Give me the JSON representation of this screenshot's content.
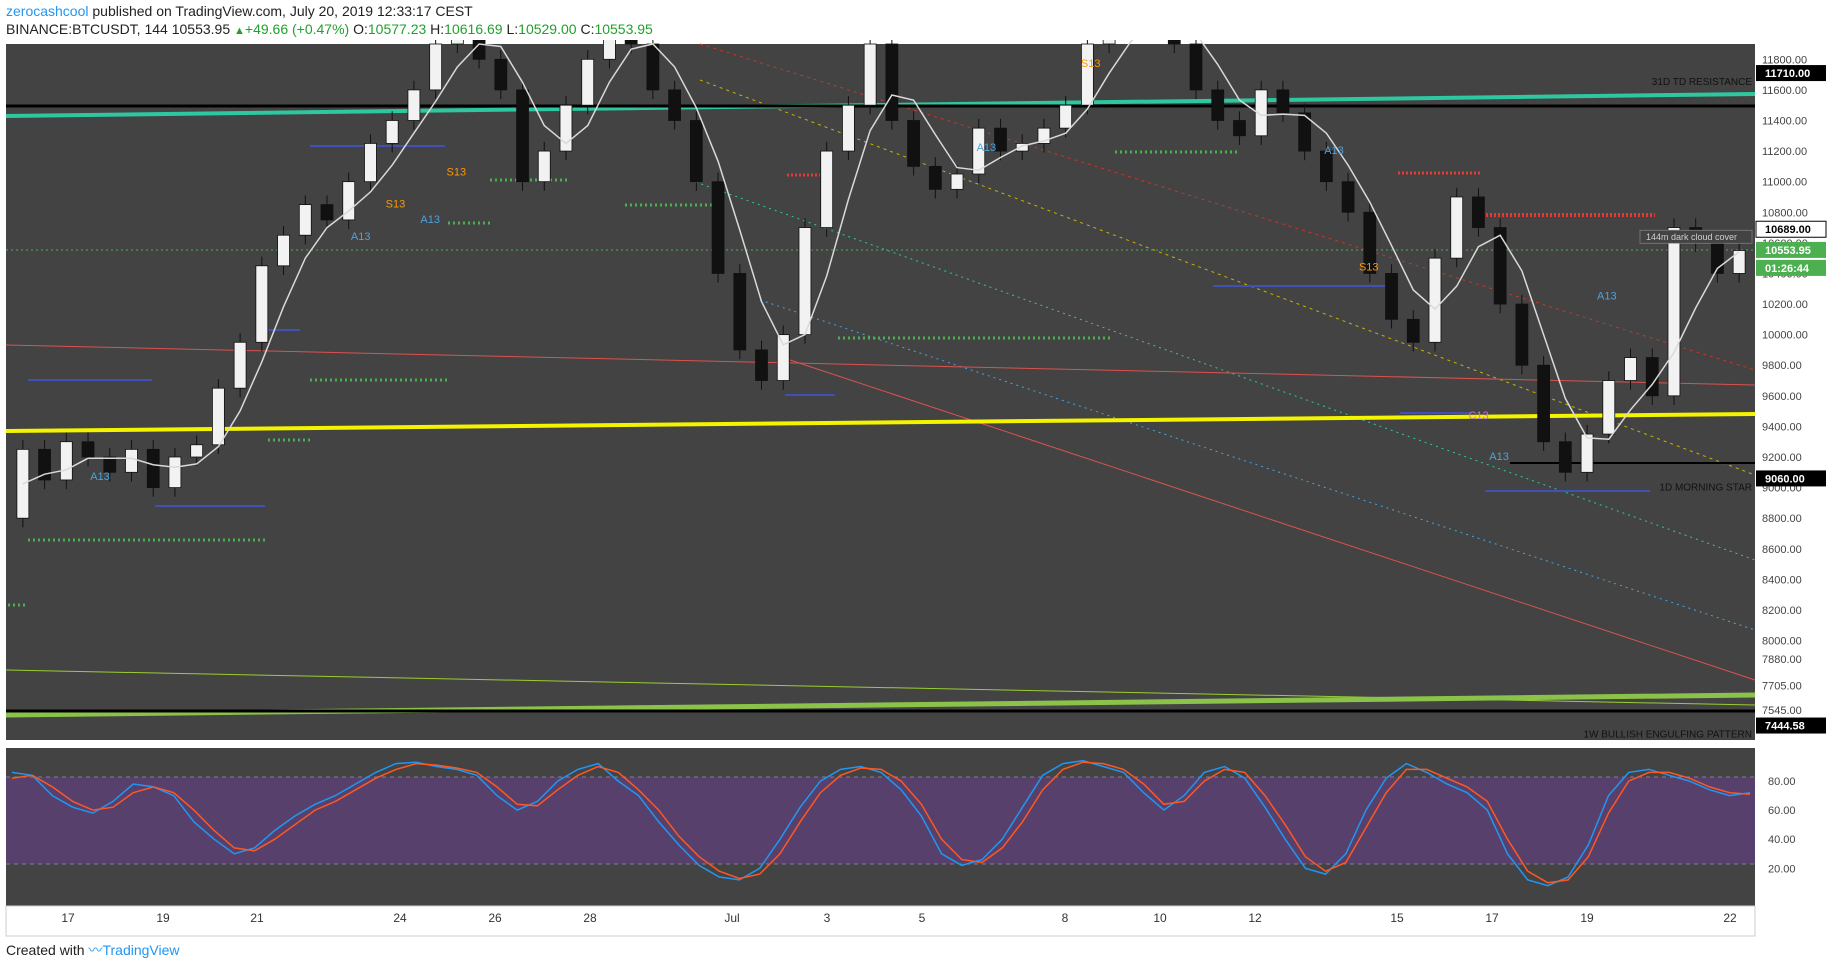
{
  "header": {
    "author": "zerocashcool",
    "published": "published on TradingView.com, July 20, 2019 12:33:17 CEST",
    "symbol": "BINANCE:BTCUSDT, 144",
    "last": "10553.95",
    "change": "+49.66 (+0.47%)",
    "o_label": "O:",
    "o_value": "10577.23",
    "h_label": "H:",
    "h_value": "10616.69",
    "l_label": "L:",
    "l_value": "10529.00",
    "c_label": "C:",
    "c_value": "10553.95"
  },
  "footer": {
    "created_with": "Created with",
    "brand": "TradingView"
  },
  "colors": {
    "pane_bg": "#434343",
    "stoch_band": "#5a3f72",
    "cyan_line": "#2ec8a0",
    "yellow_line": "#f4f400",
    "green_line": "#8bc34a",
    "price_tag": "#4caf50",
    "stoch_k": "#2196f3",
    "stoch_d": "#ff5722"
  },
  "chart_data": {
    "type": "candlestick",
    "symbol": "BINANCE:BTCUSDT",
    "interval": "144",
    "price_ticks": [
      11800,
      11600,
      11400,
      11200,
      11000,
      10800,
      10600,
      10400,
      10200,
      10000,
      9800,
      9600,
      9400,
      9200,
      9000,
      8800,
      8600,
      8400,
      8200,
      8000,
      7880,
      7705,
      7545
    ],
    "ylim": [
      7350,
      11900
    ],
    "x_ticks": [
      "17",
      "19",
      "21",
      "24",
      "26",
      "28",
      "Jul",
      "3",
      "5",
      "8",
      "10",
      "12",
      "15",
      "17",
      "19",
      "22"
    ],
    "price_labels": [
      {
        "price": 11710,
        "text": "11710.00",
        "style": "black"
      },
      {
        "price": 10689,
        "text": "10689.00",
        "style": "white"
      },
      {
        "price": 10553.95,
        "text": "10553.95",
        "style": "green"
      },
      {
        "price": 10553.95,
        "text": "01:26:44",
        "style": "green_timer"
      },
      {
        "price": 9060,
        "text": "9060.00",
        "style": "black"
      },
      {
        "price": 7444.58,
        "text": "7444.58",
        "style": "black"
      }
    ],
    "level_annotations": [
      {
        "price": 11710,
        "text": "31D TD RESISTANCE"
      },
      {
        "price": 9060,
        "text": "1D MORNING STAR"
      },
      {
        "price": 7444.58,
        "text": "1W BULLISH ENGULFING PATTERN"
      },
      {
        "price": 10689,
        "text": "144m dark cloud cover"
      }
    ],
    "markers": [
      {
        "text": "A13",
        "t": 0.045,
        "price": 9050,
        "color": "#4aa3df"
      },
      {
        "text": "A13",
        "t": 0.195,
        "price": 10620,
        "color": "#4aa3df"
      },
      {
        "text": "S13",
        "t": 0.215,
        "price": 10830,
        "color": "#ff9800"
      },
      {
        "text": "A13",
        "t": 0.235,
        "price": 10730,
        "color": "#4aa3df"
      },
      {
        "text": "S13",
        "t": 0.25,
        "price": 11040,
        "color": "#ff9800"
      },
      {
        "text": "S13",
        "t": 0.615,
        "price": 11750,
        "color": "#ff9800"
      },
      {
        "text": "A13",
        "t": 0.555,
        "price": 11200,
        "color": "#4aa3df"
      },
      {
        "text": "A13",
        "t": 0.755,
        "price": 11180,
        "color": "#4aa3df"
      },
      {
        "text": "S13",
        "t": 0.775,
        "price": 10420,
        "color": "#ff9800"
      },
      {
        "text": "C13",
        "t": 0.838,
        "price": 9450,
        "color": "#c678dd"
      },
      {
        "text": "A13",
        "t": 0.85,
        "price": 9180,
        "color": "#4aa3df"
      },
      {
        "text": "A13",
        "t": 0.912,
        "price": 10230,
        "color": "#4aa3df"
      }
    ],
    "series": [
      {
        "name": "BTCUSDT",
        "values": [
          [
            8800,
            9250
          ],
          [
            9250,
            9050
          ],
          [
            9050,
            9300
          ],
          [
            9300,
            9200
          ],
          [
            9200,
            9100
          ],
          [
            9100,
            9250
          ],
          [
            9250,
            9000
          ],
          [
            9000,
            9200
          ],
          [
            9200,
            9280
          ],
          [
            9280,
            9650
          ],
          [
            9650,
            9950
          ],
          [
            9950,
            10450
          ],
          [
            10450,
            10650
          ],
          [
            10650,
            10850
          ],
          [
            10850,
            10750
          ],
          [
            10750,
            11000
          ],
          [
            11000,
            11250
          ],
          [
            11250,
            11400
          ],
          [
            11400,
            11600
          ],
          [
            11600,
            11900
          ],
          [
            11900,
            12100
          ],
          [
            12100,
            11800
          ],
          [
            11800,
            11600
          ],
          [
            11600,
            11000
          ],
          [
            11000,
            11200
          ],
          [
            11200,
            11500
          ],
          [
            11500,
            11800
          ],
          [
            11800,
            12100
          ],
          [
            12100,
            11900
          ],
          [
            11900,
            11600
          ],
          [
            11600,
            11400
          ],
          [
            11400,
            11000
          ],
          [
            11000,
            10400
          ],
          [
            10400,
            9900
          ],
          [
            9900,
            9700
          ],
          [
            9700,
            10000
          ],
          [
            10000,
            10700
          ],
          [
            10700,
            11200
          ],
          [
            11200,
            11500
          ],
          [
            11500,
            11900
          ],
          [
            11900,
            11400
          ],
          [
            11400,
            11100
          ],
          [
            11100,
            10950
          ],
          [
            10950,
            11050
          ],
          [
            11050,
            11350
          ],
          [
            11350,
            11200
          ],
          [
            11200,
            11250
          ],
          [
            11250,
            11350
          ],
          [
            11350,
            11500
          ],
          [
            11500,
            11900
          ],
          [
            11900,
            12100
          ],
          [
            12100,
            12000
          ],
          [
            12000,
            12200
          ],
          [
            12200,
            11900
          ],
          [
            11900,
            11600
          ],
          [
            11600,
            11400
          ],
          [
            11400,
            11300
          ],
          [
            11300,
            11600
          ],
          [
            11600,
            11450
          ],
          [
            11450,
            11200
          ],
          [
            11200,
            11000
          ],
          [
            11000,
            10800
          ],
          [
            10800,
            10400
          ],
          [
            10400,
            10100
          ],
          [
            10100,
            9950
          ],
          [
            9950,
            10500
          ],
          [
            10500,
            10900
          ],
          [
            10900,
            10700
          ],
          [
            10700,
            10200
          ],
          [
            10200,
            9800
          ],
          [
            9800,
            9300
          ],
          [
            9300,
            9100
          ],
          [
            9100,
            9350
          ],
          [
            9350,
            9700
          ],
          [
            9700,
            9850
          ],
          [
            9850,
            9600
          ],
          [
            9600,
            10700
          ],
          [
            10700,
            10600
          ],
          [
            10600,
            10400
          ],
          [
            10400,
            10550
          ]
        ]
      }
    ],
    "stoch_ticks": [
      80,
      60,
      40,
      20
    ],
    "stoch_band": [
      20,
      80
    ],
    "stoch_k": [
      86,
      84,
      70,
      62,
      58,
      66,
      78,
      76,
      70,
      52,
      40,
      30,
      34,
      46,
      56,
      64,
      70,
      78,
      86,
      92,
      93,
      90,
      88,
      84,
      70,
      60,
      66,
      80,
      88,
      92,
      80,
      70,
      52,
      36,
      22,
      14,
      12,
      20,
      40,
      62,
      80,
      88,
      90,
      86,
      74,
      56,
      30,
      22,
      26,
      40,
      62,
      84,
      92,
      94,
      90,
      86,
      72,
      60,
      70,
      86,
      90,
      82,
      62,
      40,
      20,
      16,
      30,
      60,
      82,
      92,
      86,
      78,
      72,
      60,
      30,
      12,
      8,
      14,
      36,
      70,
      86,
      88,
      84,
      80,
      74,
      70,
      72
    ],
    "stoch_d": [
      82,
      84,
      76,
      66,
      60,
      62,
      72,
      76,
      72,
      60,
      46,
      34,
      32,
      40,
      50,
      60,
      66,
      74,
      82,
      88,
      92,
      91,
      89,
      86,
      76,
      64,
      63,
      74,
      84,
      90,
      86,
      74,
      60,
      42,
      28,
      18,
      13,
      16,
      30,
      52,
      72,
      84,
      89,
      88,
      80,
      64,
      40,
      26,
      24,
      34,
      52,
      74,
      88,
      93,
      92,
      88,
      78,
      64,
      66,
      80,
      88,
      86,
      70,
      50,
      28,
      18,
      24,
      48,
      72,
      88,
      88,
      82,
      76,
      66,
      40,
      18,
      10,
      12,
      28,
      58,
      80,
      86,
      86,
      82,
      76,
      72,
      71
    ]
  }
}
